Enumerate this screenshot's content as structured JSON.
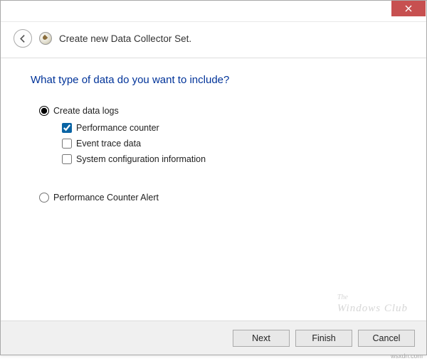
{
  "wizard": {
    "title": "Create new Data Collector Set."
  },
  "content": {
    "question": "What type of data do you want to include?",
    "radio1_label": "Create data logs",
    "radio1_checked": true,
    "check1_label": "Performance counter",
    "check1_checked": true,
    "check2_label": "Event trace data",
    "check2_checked": false,
    "check3_label": "System configuration information",
    "check3_checked": false,
    "radio2_label": "Performance Counter Alert",
    "radio2_checked": false
  },
  "buttons": {
    "next": "Next",
    "finish": "Finish",
    "cancel": "Cancel"
  },
  "watermark": {
    "line1": "The",
    "line2": "Windows Club"
  },
  "source": "wsxdn.com"
}
